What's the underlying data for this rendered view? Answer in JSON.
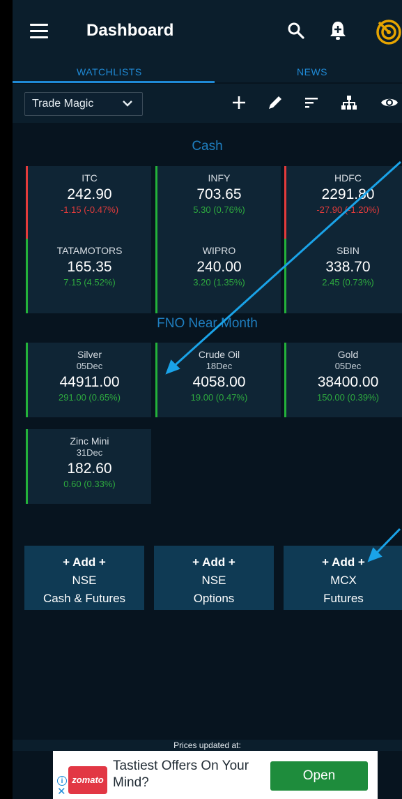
{
  "header": {
    "title": "Dashboard"
  },
  "tabs": [
    {
      "label": "WATCHLISTS"
    },
    {
      "label": "NEWS"
    }
  ],
  "toolbar": {
    "watchlist_selected": "Trade Magic"
  },
  "cash": {
    "title": "Cash",
    "items": [
      {
        "symbol": "ITC",
        "price": "242.90",
        "change": "-1.15 (-0.47%)"
      },
      {
        "symbol": "INFY",
        "price": "703.65",
        "change": "5.30 (0.76%)"
      },
      {
        "symbol": "HDFC",
        "price": "2291.80",
        "change": "-27.90 (-1.20%)"
      },
      {
        "symbol": "TATAMOTORS",
        "price": "165.35",
        "change": "7.15 (4.52%)"
      },
      {
        "symbol": "WIPRO",
        "price": "240.00",
        "change": "3.20 (1.35%)"
      },
      {
        "symbol": "SBIN",
        "price": "338.70",
        "change": "2.45 (0.73%)"
      }
    ]
  },
  "fno": {
    "title": "FNO Near Month",
    "items": [
      {
        "symbol": "Silver",
        "expiry": "05Dec",
        "price": "44911.00",
        "change": "291.00 (0.65%)"
      },
      {
        "symbol": "Crude Oil",
        "expiry": "18Dec",
        "price": "4058.00",
        "change": "19.00 (0.47%)"
      },
      {
        "symbol": "Gold",
        "expiry": "05Dec",
        "price": "38400.00",
        "change": "150.00 (0.39%)"
      },
      {
        "symbol": "Zinc Mini",
        "expiry": "31Dec",
        "price": "182.60",
        "change": "0.60 (0.33%)"
      }
    ]
  },
  "add_buttons": [
    {
      "line1": "+ Add +",
      "line2": "NSE",
      "line3": "Cash & Futures"
    },
    {
      "line1": "+ Add +",
      "line2": "NSE",
      "line3": "Options"
    },
    {
      "line1": "+ Add +",
      "line2": "MCX",
      "line3": "Futures"
    }
  ],
  "footer": {
    "prices_updated": "Prices updated at:"
  },
  "ad": {
    "brand": "zomato",
    "text": "Tastiest Offers On Your Mind?",
    "cta": "Open"
  },
  "colors": {
    "accent": "#1f8ad6",
    "positive": "#2eaa3f",
    "negative": "#e23b3b",
    "background": "#07141f",
    "card": "#0f2535",
    "button": "#0f3a54",
    "overlay_arrow": "#1aa3e8"
  },
  "icons": {
    "header": [
      "menu-icon",
      "search-icon",
      "bell-plus-icon",
      "radar-icon"
    ],
    "toolbar": [
      "plus-icon",
      "pencil-icon",
      "sort-icon",
      "hierarchy-icon",
      "eye-icon"
    ]
  }
}
